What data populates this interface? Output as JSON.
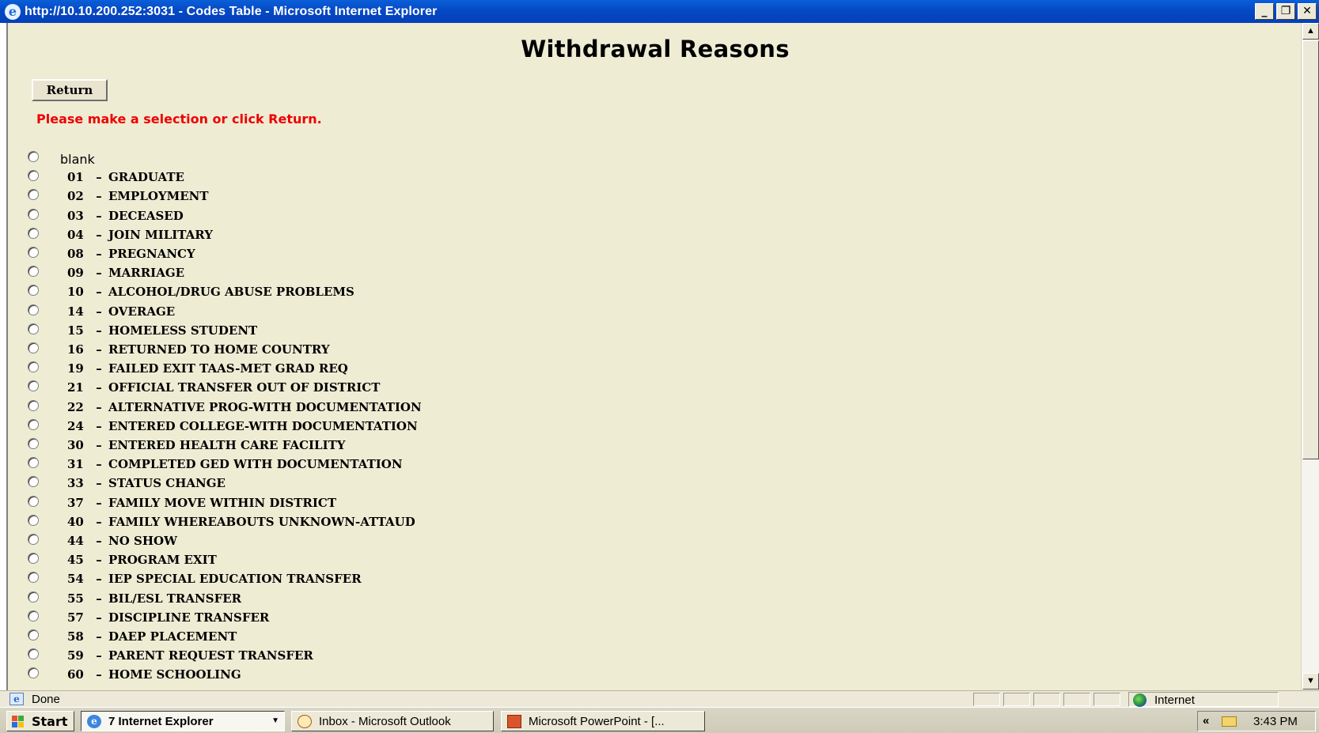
{
  "window": {
    "title": "http://10.10.200.252:3031 - Codes Table - Microsoft Internet Explorer",
    "minimize": "_",
    "restore": "❐",
    "close": "✕"
  },
  "page": {
    "title": "Withdrawal Reasons",
    "return_label": "Return",
    "instruction": "Please make a selection or click Return.",
    "blank_label": "blank",
    "separator": "–",
    "options": [
      {
        "code": "01",
        "label": "GRADUATE"
      },
      {
        "code": "02",
        "label": "EMPLOYMENT"
      },
      {
        "code": "03",
        "label": "DECEASED"
      },
      {
        "code": "04",
        "label": "JOIN MILITARY"
      },
      {
        "code": "08",
        "label": "PREGNANCY"
      },
      {
        "code": "09",
        "label": "MARRIAGE"
      },
      {
        "code": "10",
        "label": "ALCOHOL/DRUG ABUSE PROBLEMS"
      },
      {
        "code": "14",
        "label": "OVERAGE"
      },
      {
        "code": "15",
        "label": "HOMELESS STUDENT"
      },
      {
        "code": "16",
        "label": "RETURNED TO HOME COUNTRY"
      },
      {
        "code": "19",
        "label": "FAILED EXIT TAAS-MET GRAD REQ"
      },
      {
        "code": "21",
        "label": "OFFICIAL TRANSFER OUT OF DISTRICT"
      },
      {
        "code": "22",
        "label": "ALTERNATIVE PROG-WITH DOCUMENTATION"
      },
      {
        "code": "24",
        "label": "ENTERED COLLEGE-WITH DOCUMENTATION"
      },
      {
        "code": "30",
        "label": "ENTERED HEALTH CARE FACILITY"
      },
      {
        "code": "31",
        "label": "COMPLETED GED WITH DOCUMENTATION"
      },
      {
        "code": "33",
        "label": "STATUS CHANGE"
      },
      {
        "code": "37",
        "label": "FAMILY MOVE WITHIN DISTRICT"
      },
      {
        "code": "40",
        "label": "FAMILY WHEREABOUTS UNKNOWN-ATTAUD"
      },
      {
        "code": "44",
        "label": "NO SHOW"
      },
      {
        "code": "45",
        "label": "PROGRAM EXIT"
      },
      {
        "code": "54",
        "label": "IEP SPECIAL EDUCATION TRANSFER"
      },
      {
        "code": "55",
        "label": "BIL/ESL TRANSFER"
      },
      {
        "code": "57",
        "label": "DISCIPLINE TRANSFER"
      },
      {
        "code": "58",
        "label": "DAEP PLACEMENT"
      },
      {
        "code": "59",
        "label": "PARENT REQUEST TRANSFER"
      },
      {
        "code": "60",
        "label": "HOME SCHOOLING"
      }
    ]
  },
  "status_bar": {
    "status": "Done",
    "zone": "Internet"
  },
  "taskbar": {
    "start_label": "Start",
    "tasks": [
      {
        "label": "7 Internet Explorer",
        "active": true
      },
      {
        "label": "Inbox - Microsoft Outlook",
        "active": false
      },
      {
        "label": "Microsoft PowerPoint - [...",
        "active": false
      }
    ],
    "tray_chevron": "«",
    "clock": "3:43 PM"
  },
  "colors": {
    "page_background": "#efecd4",
    "instruction_text": "#ee0000",
    "title_bar": "#0549c5"
  },
  "icons": [
    "ie-icon",
    "minimize-icon",
    "restore-icon",
    "close-icon",
    "globe-icon",
    "windows-flag-icon",
    "outlook-icon",
    "powerpoint-icon",
    "mail-icon"
  ]
}
